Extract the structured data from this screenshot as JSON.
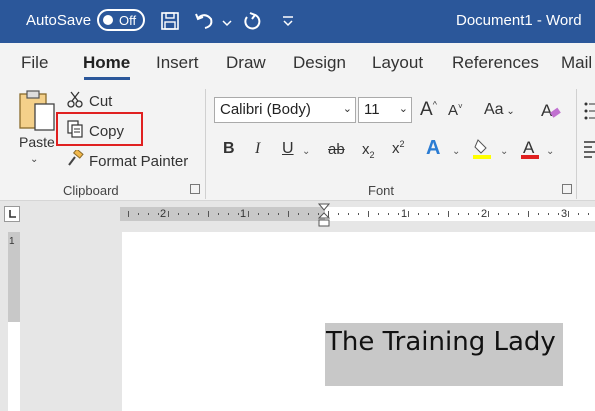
{
  "titlebar": {
    "autosave_label": "AutoSave",
    "autosave_state": "Off",
    "document_title": "Document1  -  Word",
    "background_color": "#2b579a"
  },
  "tabs": [
    {
      "label": "File"
    },
    {
      "label": "Home",
      "active": true
    },
    {
      "label": "Insert"
    },
    {
      "label": "Draw"
    },
    {
      "label": "Design"
    },
    {
      "label": "Layout"
    },
    {
      "label": "References"
    },
    {
      "label": "Mail"
    }
  ],
  "clipboard": {
    "paste_label": "Paste",
    "cut_label": "Cut",
    "copy_label": "Copy",
    "format_painter_label": "Format Painter",
    "group_label": "Clipboard",
    "highlight_color": "#e02020"
  },
  "font": {
    "font_name": "Calibri (Body)",
    "font_size": "11",
    "change_case_label": "Aa",
    "group_label": "Font",
    "highlight_color": "#ffff00",
    "font_color": "#e02020"
  },
  "ruler": {
    "numbers": [
      "2",
      "1",
      "1",
      "2",
      "3"
    ],
    "vertical_number": "1"
  },
  "document": {
    "text": "The Training Lady"
  }
}
